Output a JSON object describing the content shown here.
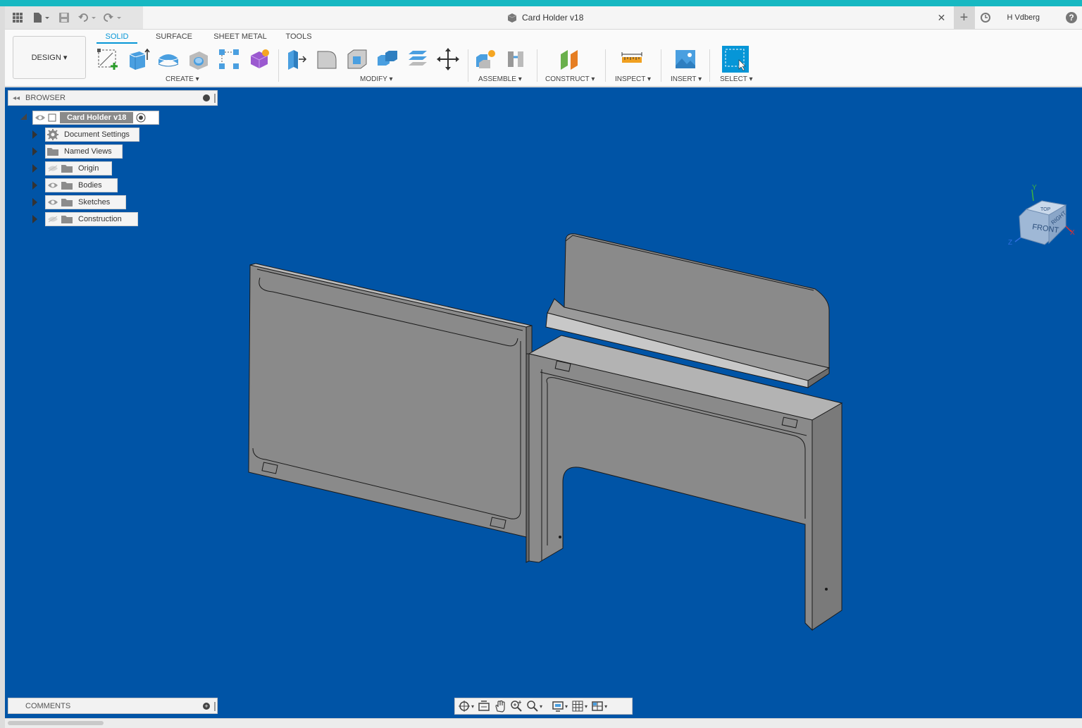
{
  "app": {
    "document_title": "Card Holder v18",
    "user": "H Vdberg",
    "close_tab": "✕",
    "new_tab": "+"
  },
  "workspace": {
    "label": "DESIGN ▾"
  },
  "tabs": [
    {
      "label": "SOLID",
      "active": true
    },
    {
      "label": "SURFACE",
      "active": false
    },
    {
      "label": "SHEET METAL",
      "active": false
    },
    {
      "label": "TOOLS",
      "active": false
    }
  ],
  "groups": {
    "create": "CREATE ▾",
    "modify": "MODIFY ▾",
    "assemble": "ASSEMBLE ▾",
    "construct": "CONSTRUCT ▾",
    "inspect": "INSPECT ▾",
    "insert": "INSERT ▾",
    "select": "SELECT ▾"
  },
  "browser": {
    "title": "BROWSER",
    "root": "Card Holder v18",
    "items": [
      {
        "label": "Document Settings",
        "icon": "gear-icon"
      },
      {
        "label": "Named Views",
        "icon": "folder-icon"
      },
      {
        "label": "Origin",
        "icon": "folder-icon",
        "visible": false
      },
      {
        "label": "Bodies",
        "icon": "folder-icon",
        "visible": true
      },
      {
        "label": "Sketches",
        "icon": "folder-icon",
        "visible": true
      },
      {
        "label": "Construction",
        "icon": "folder-icon",
        "visible": false
      }
    ]
  },
  "comments": {
    "title": "COMMENTS"
  },
  "viewcube": {
    "face": "FRONT",
    "side": "RIGHT",
    "top": "TOP",
    "axis_y": "Y",
    "axis_x": "X",
    "axis_z": "Z"
  },
  "colors": {
    "viewport": "#0054a6",
    "accent": "#0696d7",
    "body": "#8a8a8a"
  }
}
